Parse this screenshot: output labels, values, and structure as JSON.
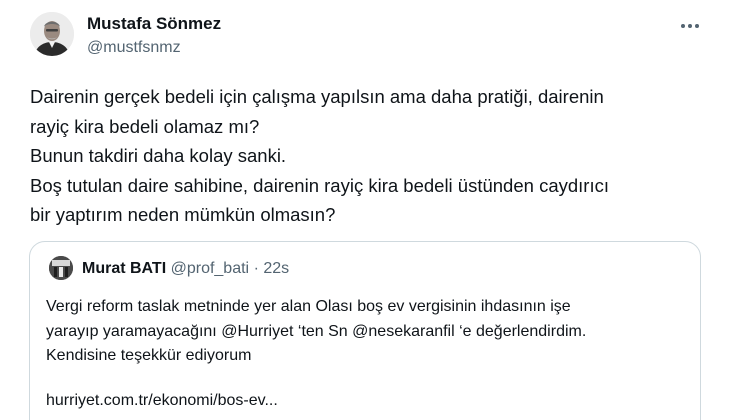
{
  "tweet": {
    "author": {
      "display_name": "Mustafa Sönmez",
      "handle": "@mustfsnmz"
    },
    "text_lines": [
      "Dairenin gerçek bedeli için çalışma yapılsın ama daha pratiği, dairenin",
      "rayiç kira bedeli olamaz mı?",
      "Bunun takdiri daha kolay sanki.",
      "Boş tutulan daire sahibine, dairenin rayiç kira bedeli üstünden caydırıcı",
      "bir yaptırım neden mümkün olmasın?"
    ],
    "more_icon": "more-horizontal-icon"
  },
  "quote": {
    "author": {
      "display_name": "Murat BATI",
      "handle": "@prof_bati",
      "separator": "·",
      "time": "22s"
    },
    "text_lines": [
      "Vergi reform taslak metninde yer alan Olası boş ev vergisinin ihdasının işe",
      "yarayıp yaramayacağını @Hurriyet ‘ten Sn @nesekaranfil ‘e değerlendirdim.",
      "Kendisine teşekkür ediyorum"
    ],
    "link": "hurriyet.com.tr/ekonomi/bos-ev..."
  },
  "colors": {
    "text": "#0f1419",
    "secondary": "#536471",
    "border": "#cfd9de"
  }
}
